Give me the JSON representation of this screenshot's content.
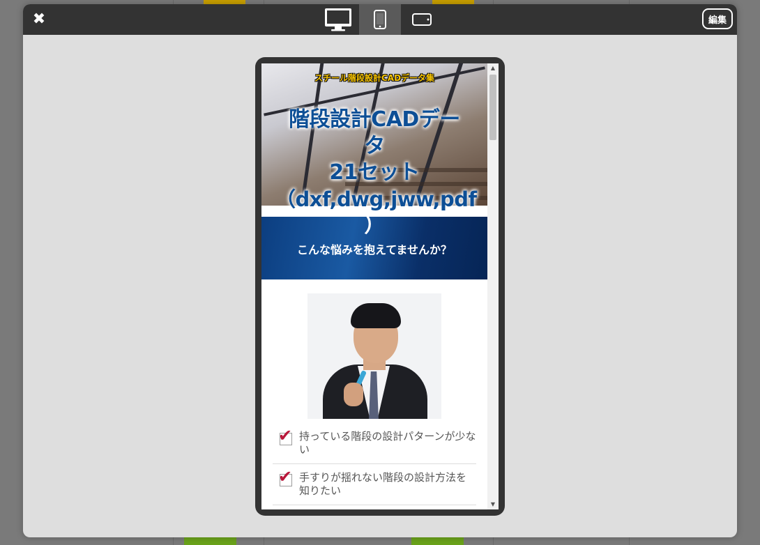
{
  "toolbar": {
    "close_icon": "close-icon",
    "devices": [
      {
        "name": "desktop",
        "icon": "monitor-icon",
        "active": false
      },
      {
        "name": "mobile",
        "icon": "smartphone-icon",
        "active": true
      },
      {
        "name": "tablet",
        "icon": "tablet-landscape-icon",
        "active": false
      }
    ],
    "edit_label": "編集"
  },
  "preview": {
    "hero": {
      "small_title": "スチール階段設計CADデータ集",
      "title_lines": [
        "階段設計CADデー",
        "タ",
        "21セット",
        "（dxf,dwg,jww,pdf",
        "）"
      ],
      "subtitle": "こんな悩みを抱えてませんか？"
    },
    "checks": [
      "持っている階段の設計パターンが少ない",
      "手すりが揺れない階段の設計方法を知りたい"
    ]
  },
  "colors": {
    "toolbar": "#333333",
    "modal_bg": "#dedede",
    "title_blue": "#0d4f96",
    "small_title_yellow": "#f7c300",
    "check_red": "#b8173a"
  }
}
